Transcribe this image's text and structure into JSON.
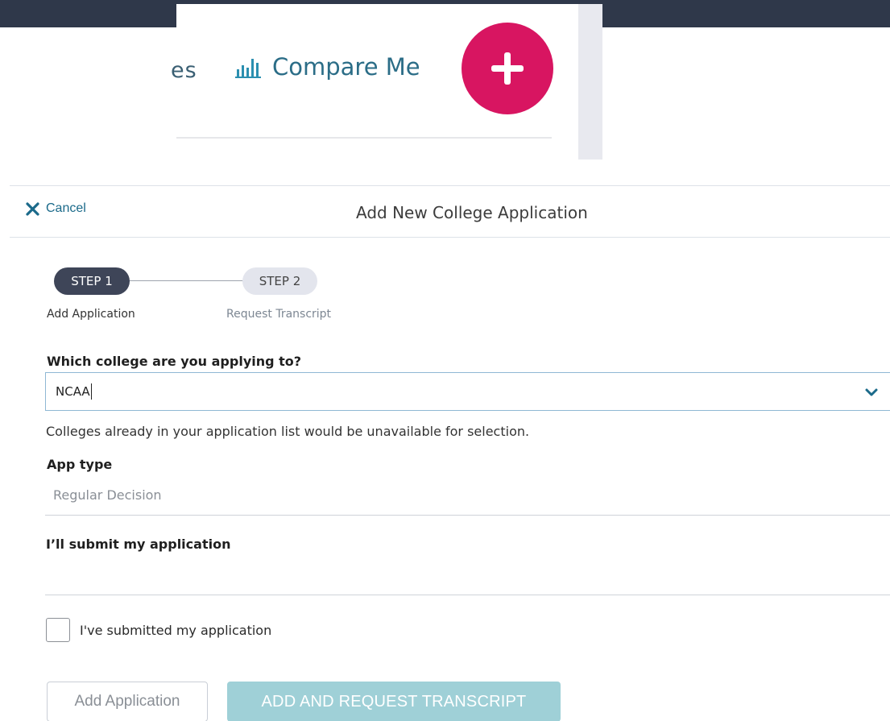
{
  "nav": {
    "partial_item_text": "es",
    "compare_label": "Compare Me",
    "icons": {
      "compare": "bar-chart-icon",
      "add": "plus-icon"
    },
    "colors": {
      "fab": "#d81561",
      "link": "#2b6d87"
    }
  },
  "modal": {
    "cancel_label": "Cancel",
    "title": "Add New College Application"
  },
  "stepper": {
    "steps": [
      {
        "label": "STEP 1",
        "caption": "Add Application",
        "active": true
      },
      {
        "label": "STEP 2",
        "caption": "Request Transcript",
        "active": false
      }
    ]
  },
  "form": {
    "college_question": "Which college are you applying to?",
    "college_value": "NCAA",
    "college_help": "Colleges already in your application list would be unavailable for selection.",
    "app_type_label": "App type",
    "app_type_value": "Regular Decision",
    "submit_label": "I’ll submit my application",
    "submitted_checkbox_label": "I've submitted my application",
    "submitted_checked": false
  },
  "buttons": {
    "add_application": "Add Application",
    "add_and_request": "ADD AND REQUEST TRANSCRIPT"
  },
  "colors": {
    "step_active": "#3e4558",
    "step_inactive": "#e3e5ed",
    "primary_disabled": "#9fd0d7",
    "cancel_icon": "#1b6a8a"
  }
}
